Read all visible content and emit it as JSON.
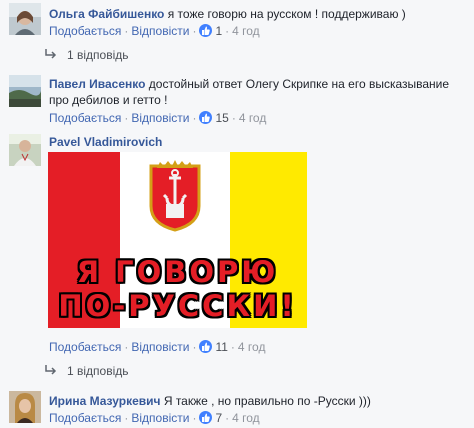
{
  "comments": [
    {
      "author": "Ольга Файбишенко",
      "text": "я тоже говорю на русском ! поддерживаю )",
      "like_label": "Подобається",
      "reply_label": "Відповісти",
      "likes": "1",
      "time": "4 год",
      "replies_label": "1 відповідь"
    },
    {
      "author": "Павел Ивасенко",
      "text": "достойный ответ Олегу Скрипке на его высказывание про дебилов и гетто !",
      "like_label": "Подобається",
      "reply_label": "Відповісти",
      "likes": "15",
      "time": "4 год"
    },
    {
      "author": "Pavel Vladimirovich",
      "text": "",
      "image": {
        "line1": "Я ГОВОРЮ",
        "line2": "ПО-РУССКИ!"
      },
      "like_label": "Подобається",
      "reply_label": "Відповісти",
      "likes": "11",
      "time": "4 год",
      "replies_label": "1 відповідь"
    },
    {
      "author": "Ирина Мазуркевич",
      "text": "Я также , но правильно по -Русски )))",
      "like_label": "Подобається",
      "reply_label": "Відповісти",
      "likes": "7",
      "time": "4 год"
    }
  ],
  "colors": {
    "author": "#365899",
    "link": "#4267b2",
    "meta": "#90949c",
    "like_badge": "#4080ff",
    "flag_red": "#e41e26",
    "flag_yellow": "#ffea00"
  }
}
